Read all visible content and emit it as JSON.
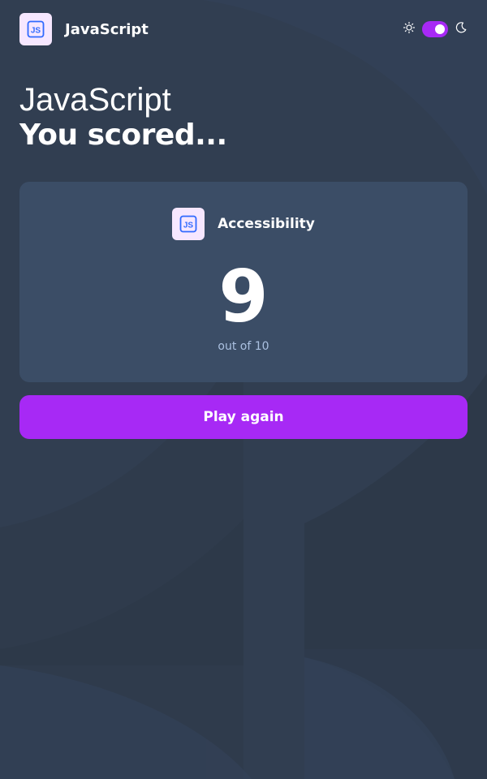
{
  "theme": {
    "background": "#313E51",
    "card_background": "#3B4D66",
    "accent": "#A729F5",
    "icon_tile_background": "#F6E7FF",
    "icon_color": "#306AFF",
    "muted_text": "#ABC1E1"
  },
  "header": {
    "subject_icon": "javascript-icon",
    "subject_label": "JavaScript",
    "theme_toggle": {
      "light_icon": "sun-icon",
      "dark_icon": "moon-icon",
      "dark_mode_on": true
    }
  },
  "heading": {
    "line1": "JavaScript",
    "line2": "You scored..."
  },
  "score_card": {
    "subject_icon": "javascript-icon",
    "subject_label": "Accessibility",
    "score": "9",
    "total_text": "out of 10"
  },
  "actions": {
    "play_again_label": "Play again"
  }
}
